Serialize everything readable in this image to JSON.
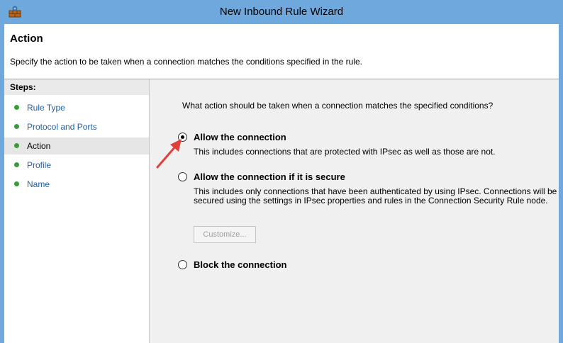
{
  "window": {
    "title": "New Inbound Rule Wizard",
    "titlebar_color": "#6fa8dc"
  },
  "header": {
    "heading": "Action",
    "description": "Specify the action to be taken when a connection matches the conditions specified in the rule."
  },
  "sidebar": {
    "title": "Steps:",
    "items": [
      {
        "label": "Rule Type",
        "current": false
      },
      {
        "label": "Protocol and Ports",
        "current": false
      },
      {
        "label": "Action",
        "current": true
      },
      {
        "label": "Profile",
        "current": false
      },
      {
        "label": "Name",
        "current": false
      }
    ],
    "dot_color": "#3c9a3c",
    "link_color": "#1f5fa8"
  },
  "main": {
    "question": "What action should be taken when a connection matches the specified conditions?",
    "options": [
      {
        "label": "Allow the connection",
        "checked": true,
        "description": "This includes connections that are protected with IPsec as well as those are not."
      },
      {
        "label": "Allow the connection if it is secure",
        "checked": false,
        "description": "This includes only connections that have been authenticated by using IPsec.  Connections will be secured using the settings in IPsec properties and rules in the Connection Security Rule node."
      },
      {
        "label": "Block the connection",
        "checked": false,
        "description": ""
      }
    ],
    "customize_button": {
      "label": "Customize...",
      "enabled": false
    }
  },
  "annotation": {
    "arrow_color": "#e0403a"
  }
}
